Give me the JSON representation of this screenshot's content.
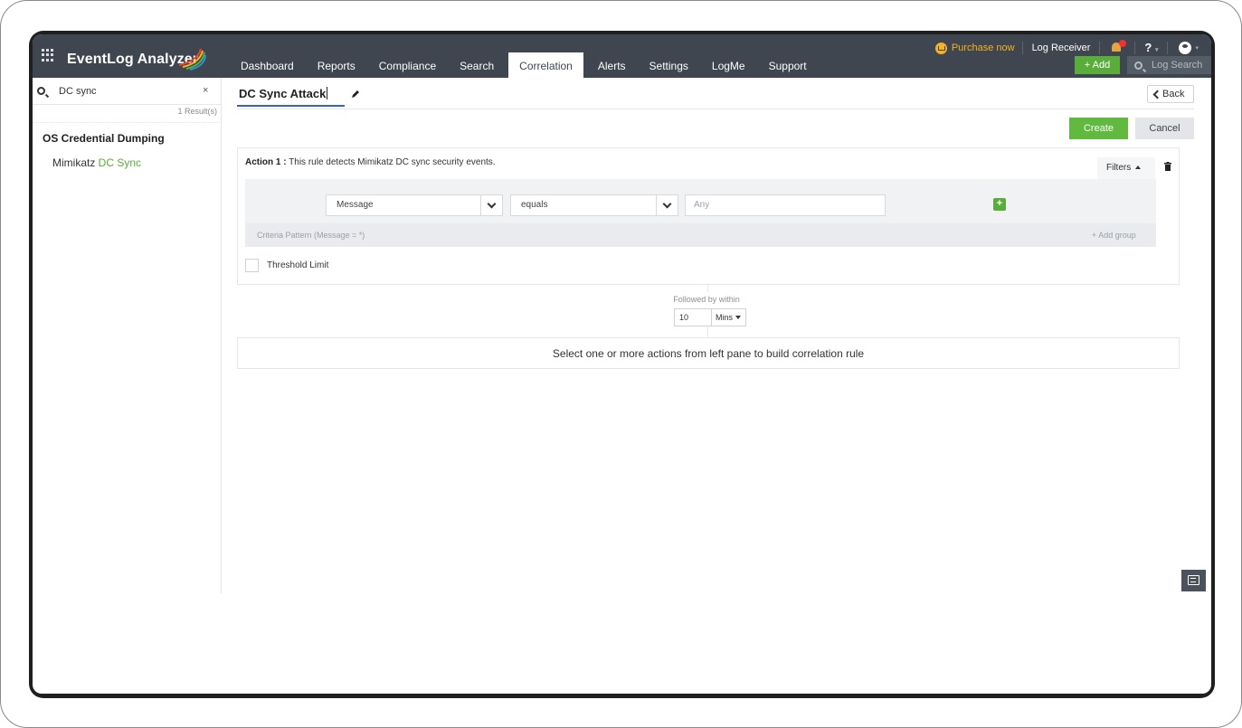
{
  "app": {
    "name": "EventLog Analyzer",
    "nav": [
      "Dashboard",
      "Reports",
      "Compliance",
      "Search",
      "Correlation",
      "Alerts",
      "Settings",
      "LogMe",
      "Support"
    ],
    "active_tab": "Correlation",
    "purchase_label": "Purchase now",
    "log_receiver_label": "Log Receiver",
    "help_label": "?",
    "add_label": "+ Add",
    "log_search_placeholder": "Log Search",
    "colors": {
      "topbar": "#3f464f",
      "accent_green": "#5aad3a",
      "purchase": "#f5b324",
      "title_underline": "#3e63a8"
    }
  },
  "left_panel": {
    "search_value": "DC sync",
    "clear_label": "×",
    "result_count": "1 Result(s)",
    "group": "OS Credential Dumping",
    "item_prefix": "Mimikatz ",
    "item_highlight": "DC Sync"
  },
  "rule": {
    "title": "DC Sync Attack",
    "back_label": "Back",
    "create_label": "Create",
    "cancel_label": "Cancel",
    "action": {
      "label_bold": "Action 1 :",
      "description": " This rule detects Mimikatz DC sync security events.",
      "filters_label": "Filters",
      "field": "Message",
      "operator": "equals",
      "value_placeholder": "Any",
      "add_criteria": "+",
      "criteria_pattern": "Criteria Pattern (Message = *)",
      "add_group": "+ Add group",
      "threshold_label": "Threshold Limit"
    },
    "followed_by_label": "Followed by within",
    "within_value": "10",
    "within_unit": "Mins",
    "empty_action_message": "Select one or more actions from left pane to build correlation rule"
  }
}
